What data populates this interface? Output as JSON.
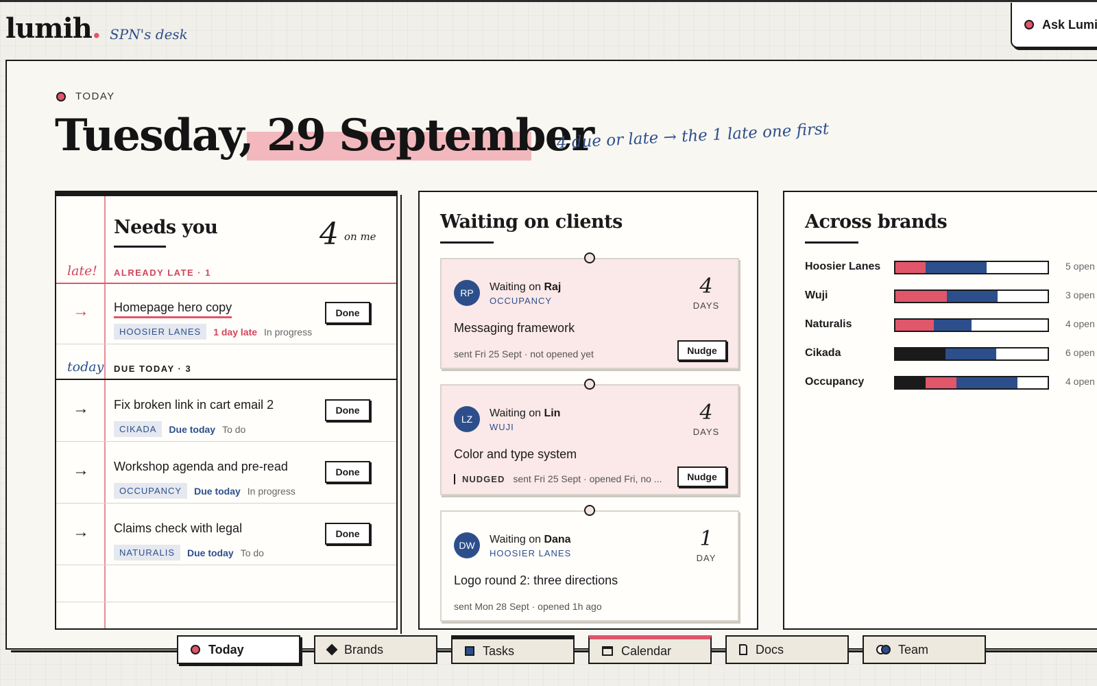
{
  "header": {
    "logo": "lumih",
    "logo_dot": ".",
    "desk": "SPN's desk",
    "ask_label": "Ask Lumih"
  },
  "today": {
    "label": "TODAY",
    "date": "Tuesday, 29 September",
    "annotation": "4 due or late → the 1 late one first"
  },
  "needs_you": {
    "title": "Needs you",
    "count": "4",
    "count_note": "on me",
    "late_side": "late!",
    "late_title": "ALREADY LATE · 1",
    "today_side": "today",
    "today_title": "DUE TODAY · 3",
    "tasks": [
      {
        "name": "Homepage hero copy",
        "brand": "HOOSIER LANES",
        "due": "1 day late",
        "status": "In progress",
        "action": "Done"
      },
      {
        "name": "Fix broken link in cart email 2",
        "brand": "CIKADA",
        "due": "Due today",
        "status": "To do",
        "action": "Done"
      },
      {
        "name": "Workshop agenda and pre-read",
        "brand": "OCCUPANCY",
        "due": "Due today",
        "status": "In progress",
        "action": "Done"
      },
      {
        "name": "Claims check with legal",
        "brand": "NATURALIS",
        "due": "Due today",
        "status": "To do",
        "action": "Done"
      }
    ]
  },
  "waiting": {
    "title": "Waiting on clients",
    "cards": [
      {
        "initials": "RP",
        "prefix": "Waiting on",
        "person": "Raj",
        "brand": "OCCUPANCY",
        "num": "4",
        "unit": "DAYS",
        "task": "Messaging framework",
        "sent": "sent Fri 25 Sept · not opened yet",
        "action": "Nudge"
      },
      {
        "initials": "LZ",
        "prefix": "Waiting on",
        "person": "Lin",
        "brand": "WUJI",
        "num": "4",
        "unit": "DAYS",
        "task": "Color and type system",
        "tag": "NUDGED",
        "sent": "sent Fri 25 Sept · opened Fri, no ...",
        "action": "Nudge"
      },
      {
        "initials": "DW",
        "prefix": "Waiting on",
        "person": "Dana",
        "brand": "HOOSIER LANES",
        "num": "1",
        "unit": "DAY",
        "task": "Logo round 2: three directions",
        "sent": "sent Mon 28 Sept · opened 1h ago"
      }
    ]
  },
  "brands": {
    "title": "Across brands",
    "rows": [
      {
        "name": "Hoosier Lanes",
        "open": "5 open",
        "segments": [
          {
            "color": "#e0566a",
            "frac": 0.2
          },
          {
            "color": "#2c4f8c",
            "frac": 0.4
          }
        ]
      },
      {
        "name": "Wuji",
        "open": "3 open",
        "segments": [
          {
            "color": "#e0566a",
            "frac": 0.34
          },
          {
            "color": "#2c4f8c",
            "frac": 0.33
          }
        ]
      },
      {
        "name": "Naturalis",
        "open": "4 open",
        "segments": [
          {
            "color": "#e0566a",
            "frac": 0.25
          },
          {
            "color": "#2c4f8c",
            "frac": 0.25
          }
        ]
      },
      {
        "name": "Cikada",
        "open": "6 open",
        "segments": [
          {
            "color": "#1a1a1a",
            "frac": 0.33
          },
          {
            "color": "#2c4f8c",
            "frac": 0.33
          }
        ]
      },
      {
        "name": "Occupancy",
        "open": "4 open",
        "segments": [
          {
            "color": "#1a1a1a",
            "frac": 0.2
          },
          {
            "color": "#e0566a",
            "frac": 0.2
          },
          {
            "color": "#2c4f8c",
            "frac": 0.4
          }
        ]
      }
    ]
  },
  "nav": {
    "today": "Today",
    "brands": "Brands",
    "tasks": "Tasks",
    "calendar": "Calendar",
    "docs": "Docs",
    "team": "Team"
  },
  "colors": {
    "accent": "#e0566a",
    "blue": "#2c4f8c",
    "ink": "#1a1a1a"
  }
}
